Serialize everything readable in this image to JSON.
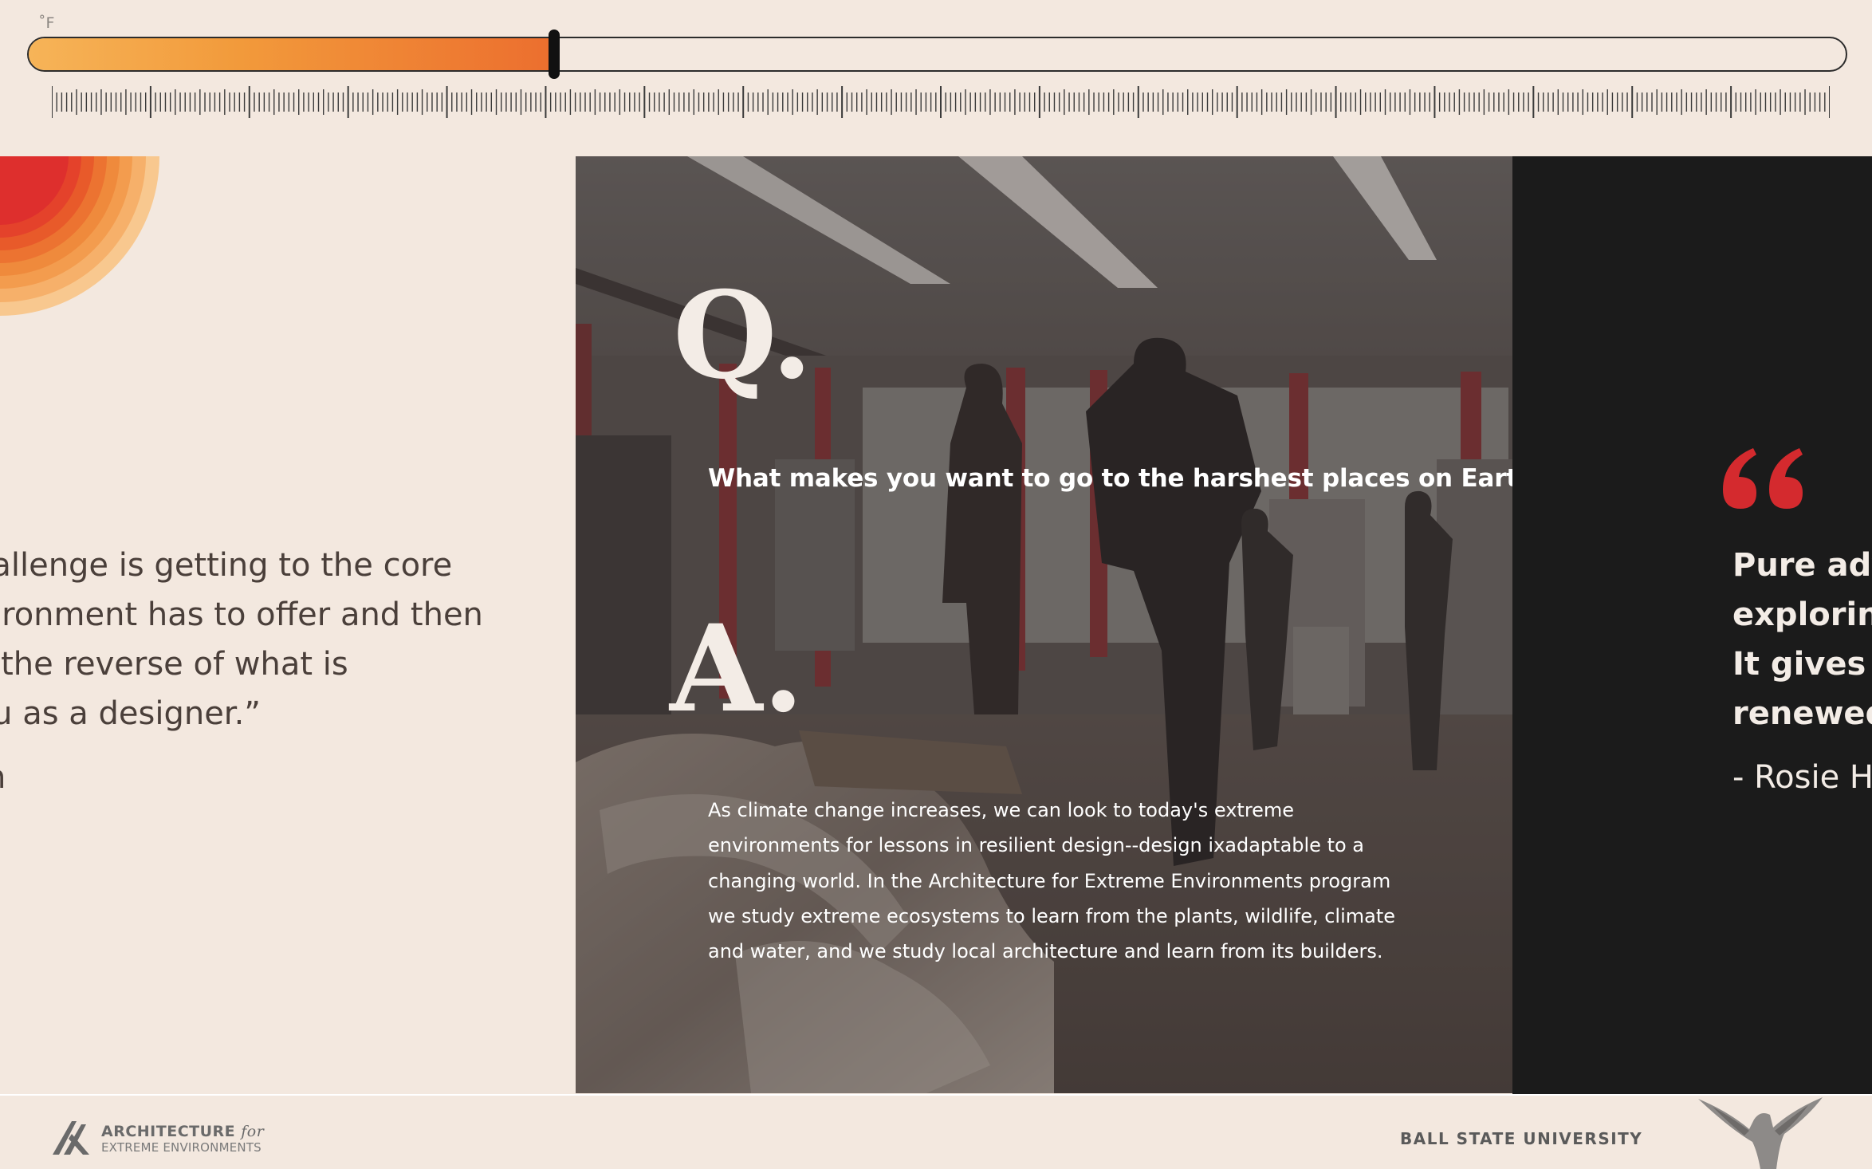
{
  "slider": {
    "unit_label": "˚F",
    "value_fraction": 0.29
  },
  "left_quote": {
    "lines": [
      "challenge is getting to the core",
      "nvironment has to offer and then",
      "ke the reverse of what is",
      "you as a designer.”"
    ],
    "attribution": "n"
  },
  "qa": {
    "q_letter": "Q.",
    "question": "What makes you want to go to the harshest places on Earth?",
    "a_letter": "A.",
    "answer": "As climate change increases, we can look to today's extreme environments for lessons in resilient design--design ixadaptable to a changing world. In the Architecture for Extreme Environments program we study extreme ecosystems to learn from the plants, wildlife, climate and water, and we study local architecture and learn from its builders."
  },
  "right_quote": {
    "lines": [
      "Pure adve",
      "exploring",
      "It gives m",
      "renewed"
    ],
    "attribution": "- Rosie Ha"
  },
  "footer": {
    "logo_line1": "ARCHITECTURE",
    "logo_for": "for",
    "logo_line2": "EXTREME ENVIRONMENTS",
    "university": "BALL STATE UNIVERSITY"
  },
  "colors": {
    "background": "#f3e8df",
    "slider_fill_start": "#f6b458",
    "slider_fill_end": "#ec6e2e",
    "quote_mark": "#d42a2e",
    "dark_panel": "#1b1b1b"
  },
  "icons": [
    "temperature-slider-thumb",
    "rainbow-arc-graphic",
    "quote-mark-icon",
    "aee-logo-icon",
    "cardinal-logo-icon"
  ]
}
